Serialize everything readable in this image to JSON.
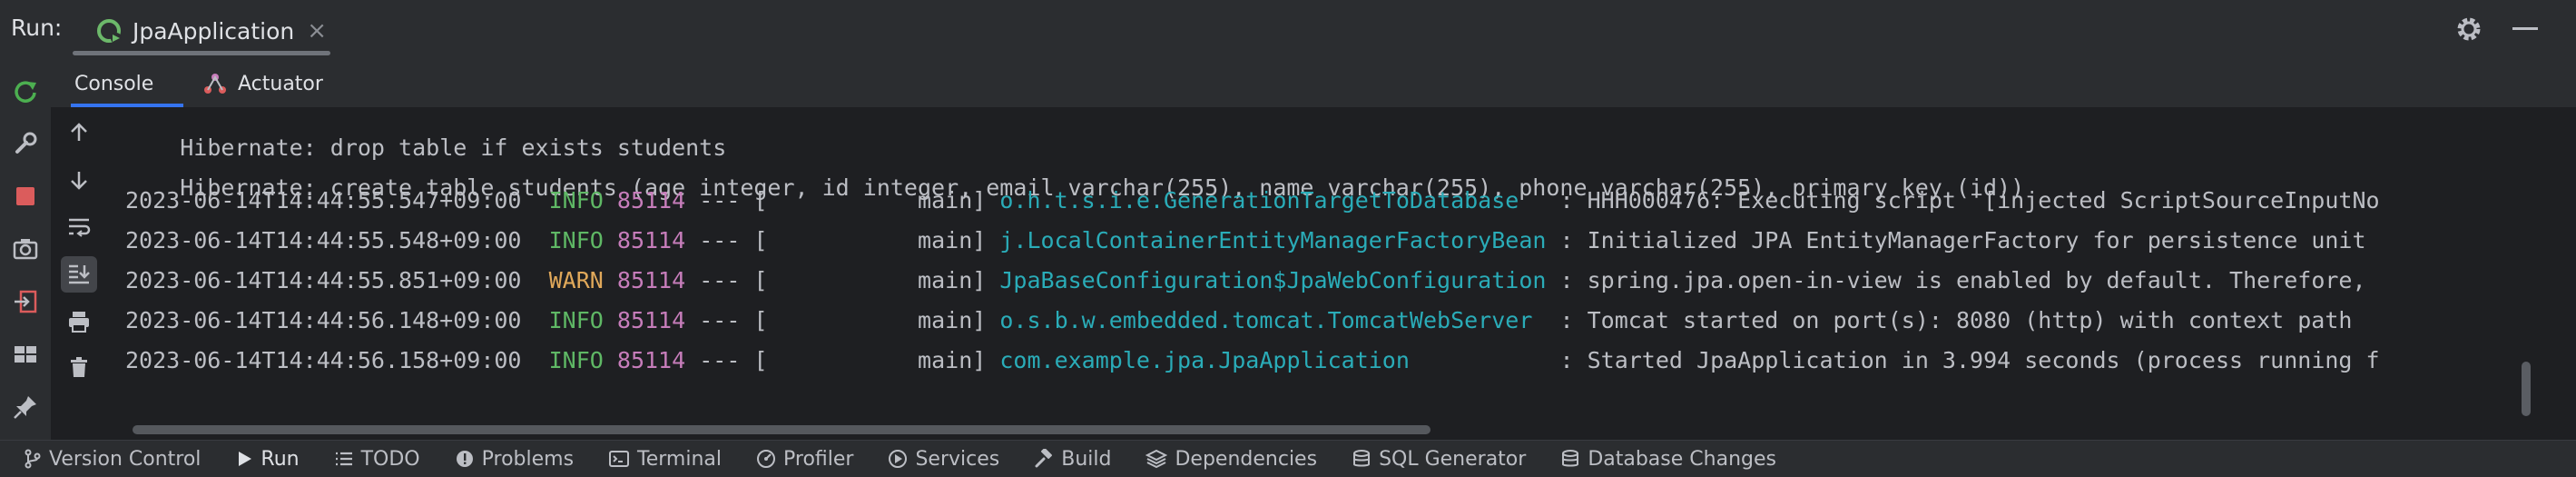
{
  "titlebar": {
    "run_label": "Run:",
    "tab_title": "JpaApplication",
    "close_glyph": "×"
  },
  "console_tabs": {
    "console_label": "Console",
    "actuator_label": "Actuator"
  },
  "console": {
    "lines": [
      {
        "text": "Hibernate: drop table if exists students"
      },
      {
        "text": "Hibernate: create table students (age integer, id integer, email varchar(255), name varchar(255), phone varchar(255), primary key (id))"
      },
      {
        "timestamp": "2023-06-14T14:44:55.547+09:00",
        "level": "INFO",
        "pid": "85114",
        "sep": "---",
        "thread": "[           main]",
        "logger": "o.h.t.s.i.e.GenerationTargetToDatabase",
        "message": ": HHH000476: Executing script '[injected ScriptSourceInputNo"
      },
      {
        "timestamp": "2023-06-14T14:44:55.548+09:00",
        "level": "INFO",
        "pid": "85114",
        "sep": "---",
        "thread": "[           main]",
        "logger": "j.LocalContainerEntityManagerFactoryBean",
        "message": ": Initialized JPA EntityManagerFactory for persistence unit"
      },
      {
        "timestamp": "2023-06-14T14:44:55.851+09:00",
        "level": "WARN",
        "pid": "85114",
        "sep": "---",
        "thread": "[           main]",
        "logger": "JpaBaseConfiguration$JpaWebConfiguration",
        "message": ": spring.jpa.open-in-view is enabled by default. Therefore,"
      },
      {
        "timestamp": "2023-06-14T14:44:56.148+09:00",
        "level": "INFO",
        "pid": "85114",
        "sep": "---",
        "thread": "[           main]",
        "logger": "o.s.b.w.embedded.tomcat.TomcatWebServer",
        "message": ": Tomcat started on port(s): 8080 (http) with context path"
      },
      {
        "timestamp": "2023-06-14T14:44:56.158+09:00",
        "level": "INFO",
        "pid": "85114",
        "sep": "---",
        "thread": "[           main]",
        "logger": "com.example.jpa.JpaApplication",
        "message": ": Started JpaApplication in 3.994 seconds (process running f"
      }
    ]
  },
  "bottom_bar": {
    "tabs": [
      {
        "label": "Version Control",
        "icon": "branch-icon"
      },
      {
        "label": "Run",
        "icon": "run-icon",
        "active": true
      },
      {
        "label": "TODO",
        "icon": "list-icon"
      },
      {
        "label": "Problems",
        "icon": "problems-icon"
      },
      {
        "label": "Terminal",
        "icon": "terminal-icon"
      },
      {
        "label": "Profiler",
        "icon": "profiler-icon"
      },
      {
        "label": "Services",
        "icon": "services-icon"
      },
      {
        "label": "Build",
        "icon": "hammer-icon"
      },
      {
        "label": "Dependencies",
        "icon": "dependencies-icon"
      },
      {
        "label": "SQL Generator",
        "icon": "database-icon"
      },
      {
        "label": "Database Changes",
        "icon": "database-changes-icon"
      }
    ]
  },
  "colors": {
    "info": "#5fb865",
    "warn": "#e0a85a",
    "pid": "#c77dbb",
    "logger": "#2aacb8",
    "rerun": "#4caf50",
    "stop": "#db5c5c"
  }
}
